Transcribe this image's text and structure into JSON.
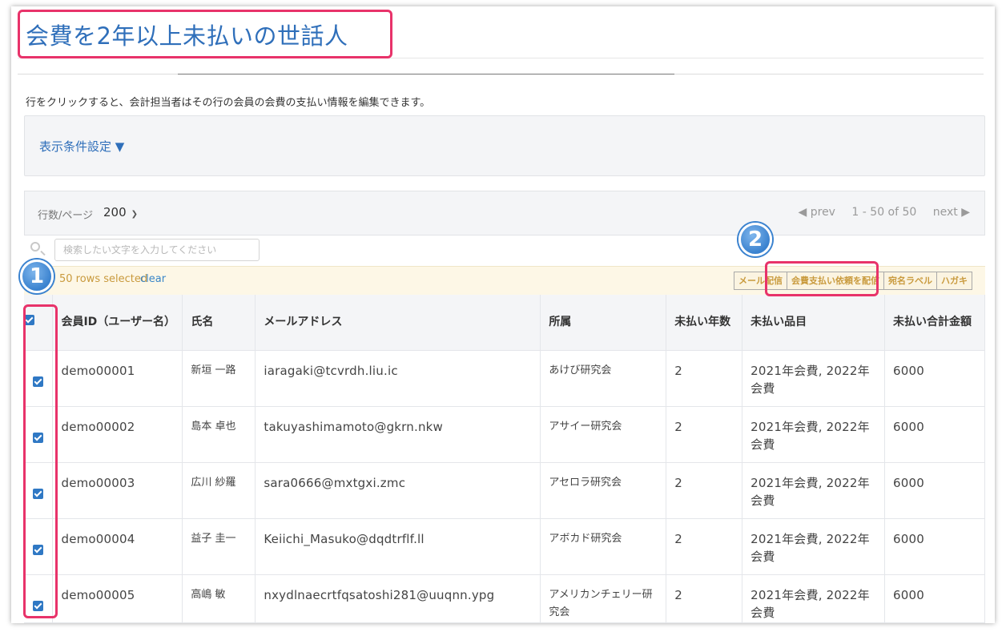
{
  "page": {
    "title": "会費を2年以上未払いの世話人",
    "instruction": "行をクリックすると、会計担当者はその行の会員の会費の支払い情報を編集できます。"
  },
  "filter": {
    "toggle_label": "表示条件設定 ▼"
  },
  "pagination": {
    "rows_label": "行数/ページ",
    "rows_value": "200",
    "prev_label": "◀ prev",
    "range_text": "1 - 50 of 50",
    "next_label": "next ▶"
  },
  "search": {
    "placeholder": "検索したい文字を入力してください"
  },
  "selection": {
    "count_text": "50 rows selected",
    "clear_label": "clear",
    "actions": [
      "メール配信",
      "会費支払い依頼を配信",
      "宛名ラベル",
      "ハガキ"
    ]
  },
  "table": {
    "columns": [
      "会員ID（ユーザー名）",
      "氏名",
      "メールアドレス",
      "所属",
      "未払い年数",
      "未払い品目",
      "未払い合計金額"
    ],
    "rows": [
      {
        "id": "demo00001",
        "name": "新垣 一路",
        "email": "iaragaki@tcvrdh.liu.ic",
        "org": "あけび研究会",
        "years": "2",
        "items": "2021年会費, 2022年会費",
        "amount": "6000"
      },
      {
        "id": "demo00002",
        "name": "島本 卓也",
        "email": "takuyashimamoto@gkrn.nkw",
        "org": "アサイー研究会",
        "years": "2",
        "items": "2021年会費, 2022年会費",
        "amount": "6000"
      },
      {
        "id": "demo00003",
        "name": "広川 紗羅",
        "email": "sara0666@mxtgxi.zmc",
        "org": "アセロラ研究会",
        "years": "2",
        "items": "2021年会費, 2022年会費",
        "amount": "6000"
      },
      {
        "id": "demo00004",
        "name": "益子 圭一",
        "email": "Keiichi_Masuko@dqdtrflf.ll",
        "org": "アボカド研究会",
        "years": "2",
        "items": "2021年会費, 2022年会費",
        "amount": "6000"
      },
      {
        "id": "demo00005",
        "name": "高嶋 敏",
        "email": "nxydlnaecrtfqsatoshi281@uuqnn.ypg",
        "org": "アメリカンチェリー研究会",
        "years": "2",
        "items": "2021年会費, 2022年会費",
        "amount": "6000"
      }
    ]
  },
  "annotations": {
    "badge_1": "1",
    "badge_2": "2"
  },
  "colors": {
    "accent": "#2f6fba",
    "highlight": "#e8336a",
    "checkbox": "#2f78c4",
    "selection_text": "#c99a3d"
  }
}
